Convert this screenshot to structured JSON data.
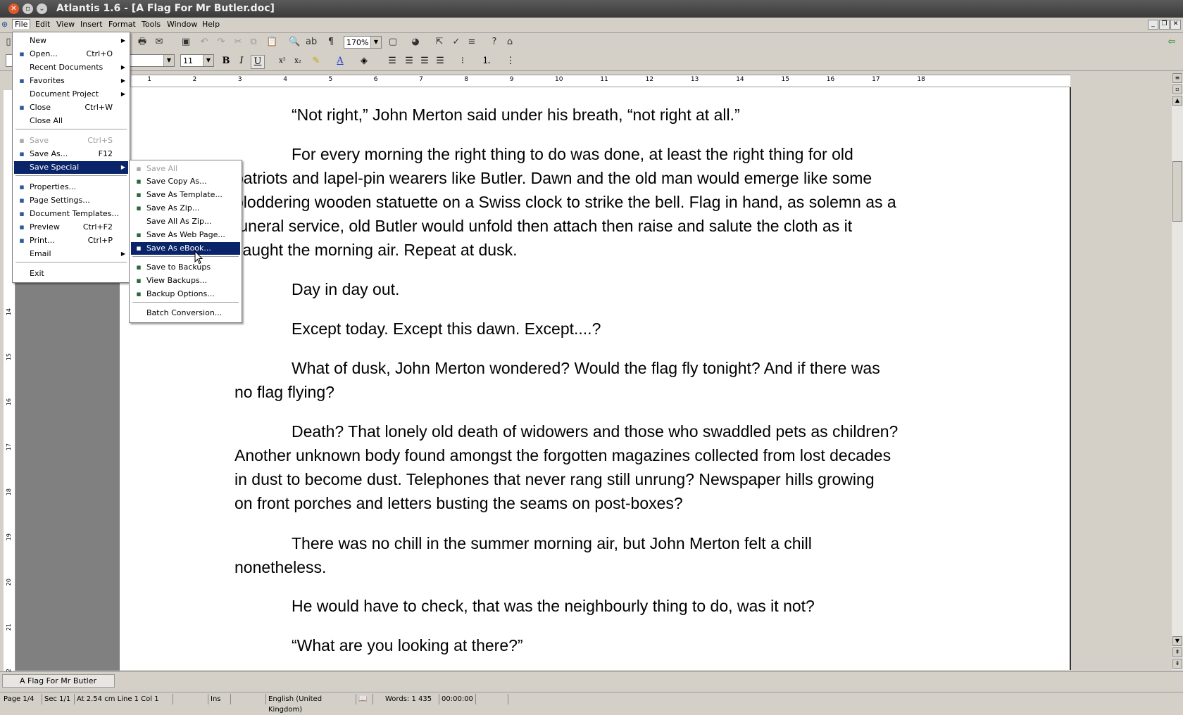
{
  "window": {
    "title": "Atlantis 1.6 - [A Flag For Mr Butler.doc]"
  },
  "menubar": [
    "File",
    "Edit",
    "View",
    "Insert",
    "Format",
    "Tools",
    "Window",
    "Help"
  ],
  "toolbar": {
    "zoom": "170%",
    "font_size": "11"
  },
  "file_menu": [
    {
      "label": "New",
      "shortcut": "",
      "submenu": true,
      "icon": "",
      "disabled": false
    },
    {
      "label": "Open...",
      "shortcut": "Ctrl+O",
      "submenu": false,
      "icon": "folder-open-icon",
      "disabled": false
    },
    {
      "label": "Recent Documents",
      "shortcut": "",
      "submenu": true,
      "icon": "",
      "disabled": false
    },
    {
      "label": "Favorites",
      "shortcut": "",
      "submenu": true,
      "icon": "star-icon",
      "disabled": false
    },
    {
      "label": "Document Project",
      "shortcut": "",
      "submenu": true,
      "icon": "",
      "disabled": false
    },
    {
      "label": "Close",
      "shortcut": "Ctrl+W",
      "submenu": false,
      "icon": "close-doc-icon",
      "disabled": false
    },
    {
      "label": "Close All",
      "shortcut": "",
      "submenu": false,
      "icon": "",
      "disabled": false
    },
    {
      "label": "Save",
      "shortcut": "Ctrl+S",
      "submenu": false,
      "icon": "disk-icon",
      "disabled": true
    },
    {
      "label": "Save As...",
      "shortcut": "F12",
      "submenu": false,
      "icon": "disk-icon",
      "disabled": false
    },
    {
      "label": "Save Special",
      "shortcut": "",
      "submenu": true,
      "icon": "",
      "disabled": false,
      "selected": true
    },
    {
      "label": "Properties...",
      "shortcut": "",
      "submenu": false,
      "icon": "properties-icon",
      "disabled": false
    },
    {
      "label": "Page Settings...",
      "shortcut": "",
      "submenu": false,
      "icon": "page-settings-icon",
      "disabled": false
    },
    {
      "label": "Document Templates...",
      "shortcut": "",
      "submenu": false,
      "icon": "template-icon",
      "disabled": false
    },
    {
      "label": "Preview",
      "shortcut": "Ctrl+F2",
      "submenu": false,
      "icon": "preview-icon",
      "disabled": false
    },
    {
      "label": "Print...",
      "shortcut": "Ctrl+P",
      "submenu": false,
      "icon": "printer-icon",
      "disabled": false
    },
    {
      "label": "Email",
      "shortcut": "",
      "submenu": true,
      "icon": "",
      "disabled": false
    },
    {
      "label": "Exit",
      "shortcut": "",
      "submenu": false,
      "icon": "",
      "disabled": false
    }
  ],
  "save_special_menu": [
    {
      "label": "Save All",
      "disabled": true,
      "icon": "save-all-icon"
    },
    {
      "label": "Save Copy As...",
      "disabled": false,
      "icon": "save-copy-icon"
    },
    {
      "label": "Save As Template...",
      "disabled": false,
      "icon": "save-template-icon"
    },
    {
      "label": "Save As Zip...",
      "disabled": false,
      "icon": "zip-icon"
    },
    {
      "label": "Save All As Zip...",
      "disabled": false,
      "icon": ""
    },
    {
      "label": "Save As Web Page...",
      "disabled": false,
      "icon": "web-page-icon"
    },
    {
      "label": "Save As eBook...",
      "disabled": false,
      "icon": "ebook-icon",
      "selected": true
    },
    {
      "label": "Save to Backups",
      "disabled": false,
      "icon": "backup-icon"
    },
    {
      "label": "View Backups...",
      "disabled": false,
      "icon": "view-backups-icon"
    },
    {
      "label": "Backup Options...",
      "disabled": false,
      "icon": "backup-options-icon"
    },
    {
      "label": "Batch Conversion...",
      "disabled": false,
      "icon": ""
    }
  ],
  "ruler_numbers": [
    "1",
    "2",
    "3",
    "4",
    "5",
    "6",
    "7",
    "8",
    "9",
    "10",
    "11",
    "12",
    "13",
    "14",
    "15",
    "16",
    "17",
    "18"
  ],
  "vruler_numbers": [
    "14",
    "15",
    "16",
    "17",
    "18",
    "19",
    "20",
    "21",
    "22"
  ],
  "document": {
    "paragraphs": [
      "“Not right,” John Merton said under his breath, “not right at all.”",
      "For every morning the right thing to do was done, at least the right thing for old",
      "patriots and lapel-pin wearers like Butler.  Dawn and the old man would emerge like some",
      "ploddering wooden statuette on a Swiss clock to strike the bell.  Flag in hand, as solemn as a",
      "funeral service, old Butler would unfold then attach then raise and salute the cloth as it",
      "caught the morning air.  Repeat at dusk.",
      "Day in day out.",
      "Except today.  Except this dawn.  Except....?",
      "What of dusk, John Merton wondered?  Would the flag fly tonight?  And if there was",
      "no flag flying?",
      "Death?  That lonely old death of widowers and those who swaddled pets as children?",
      "Another unknown body found amongst the forgotten magazines collected from lost decades",
      "in dust to become dust.  Telephones that never rang still unrung?  Newspaper hills growing",
      "on front porches and letters busting the seams on post-boxes?",
      "There was no chill in the summer morning air, but John Merton felt a chill",
      "nonetheless.",
      "He would have to check, that was the neighbourly thing to do, was it not?",
      "“What are you looking at there?”"
    ]
  },
  "tab": {
    "label": "A Flag For Mr Butler"
  },
  "status": {
    "page": "Page 1/4",
    "section": "Sec 1/1",
    "position": "At 2.54 cm  Line 1  Col 1",
    "mode": "Ins",
    "language": "English (United Kingdom)",
    "words": "Words: 1 435",
    "time": "00:00:00"
  },
  "colors": {
    "selection": "#0a246a",
    "chrome": "#d4d0c8",
    "workspace": "#808080"
  }
}
